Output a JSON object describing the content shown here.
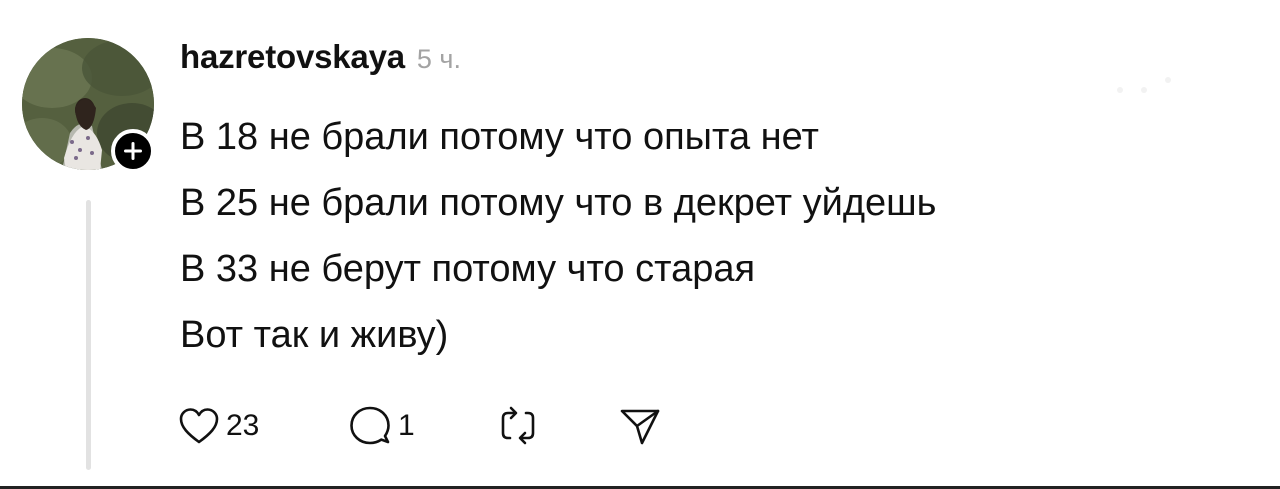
{
  "post": {
    "username": "hazretovskaya",
    "timestamp": "5 ч.",
    "lines": [
      "В 18 не брали потому что опыта нет",
      "В 25 не брали потому что в декрет уйдешь",
      "В 33 не берут потому что старая",
      "Вот так и живу)"
    ],
    "likes_count": "23",
    "comments_count": "1"
  },
  "icons": {
    "like": "heart-icon",
    "comment": "speech-bubble-icon",
    "repost": "repost-icon",
    "share": "paper-plane-icon",
    "follow": "plus-icon"
  },
  "colors": {
    "text": "#111111",
    "muted": "#a3a3a3",
    "thread_line": "#e2e2e2",
    "badge": "#000000"
  }
}
